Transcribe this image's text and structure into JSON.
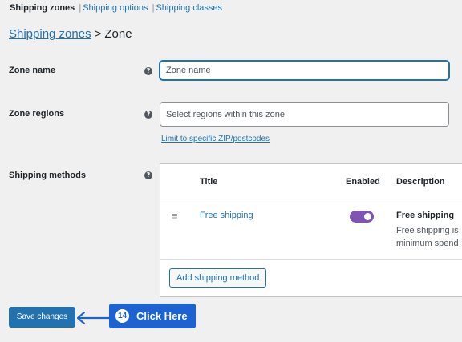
{
  "subnav": {
    "current": "Shipping zones",
    "links": [
      "Shipping options",
      "Shipping classes"
    ],
    "separator": "|"
  },
  "breadcrumb": {
    "parent": "Shipping zones",
    "arrow": ">",
    "current": "Zone"
  },
  "help_glyph": "?",
  "form": {
    "zone_name": {
      "label": "Zone name",
      "value": "",
      "placeholder": "Zone name"
    },
    "zone_regions": {
      "label": "Zone regions",
      "value": "",
      "placeholder": "Select regions within this zone",
      "limit_link": "Limit to specific ZIP/postcodes"
    },
    "shipping_methods": {
      "label": "Shipping methods"
    }
  },
  "methods_table": {
    "headers": {
      "title": "Title",
      "enabled": "Enabled",
      "description": "Description"
    },
    "rows": [
      {
        "handle": "≡",
        "title": "Free shipping",
        "enabled": true,
        "desc_title": "Free shipping",
        "desc_line1": "Free shipping is",
        "desc_line2": "minimum spend"
      }
    ],
    "add_button": "Add shipping method"
  },
  "save_button": "Save changes",
  "callout": {
    "number": "14",
    "text": "Click Here"
  },
  "colors": {
    "accent": "#2271b1",
    "toggle": "#7f54b3",
    "callout": "#1c62d0"
  }
}
